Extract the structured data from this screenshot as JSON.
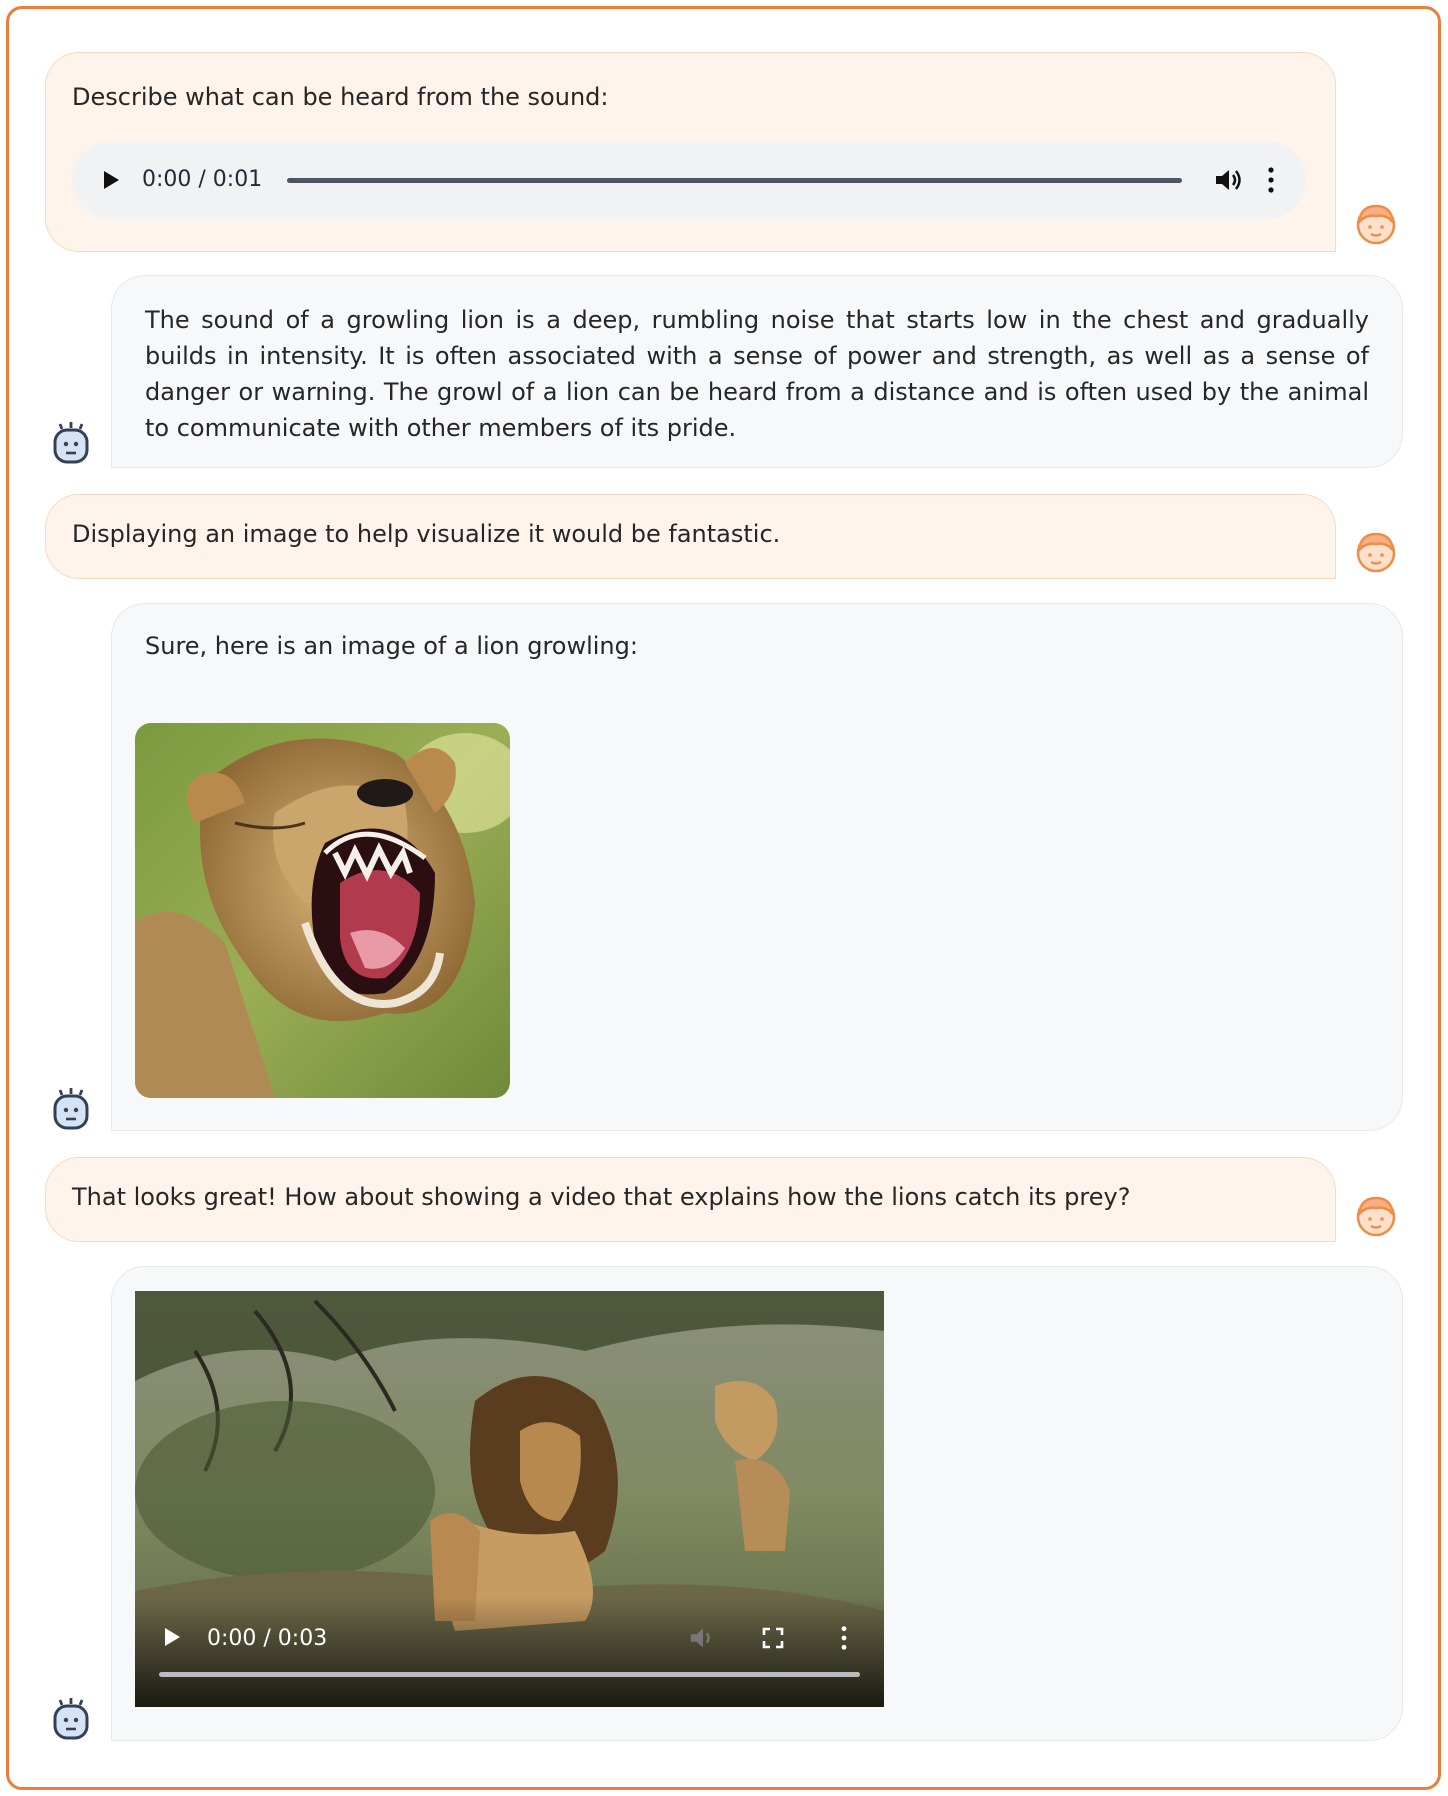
{
  "conversation": {
    "m1": {
      "text": "Describe what can be heard from the sound:",
      "audio_time": "0:00 / 0:01"
    },
    "m2": {
      "text": "The sound of a growling lion is a deep, rumbling noise that starts low in the chest and gradually builds in intensity. It is often associated with a sense of power and strength, as well as a sense of danger or warning. The growl of a lion can be heard from a distance and is often used by the animal to communicate with other members of its pride."
    },
    "m3": {
      "text": "Displaying an image to help visualize it would be fantastic."
    },
    "m4": {
      "text": "Sure, here is an image of a lion growling:"
    },
    "m5": {
      "text": "That looks great! How about showing a video that explains how the lions catch its prey?"
    },
    "m6": {
      "video_time": "0:00 / 0:03"
    }
  },
  "icons": {
    "user_avatar": "user-avatar-icon",
    "bot_avatar": "robot-avatar-icon",
    "play": "play-icon",
    "volume": "volume-icon",
    "more": "more-vertical-icon",
    "fullscreen": "fullscreen-icon"
  },
  "colors": {
    "frame_border": "#ed7d3a",
    "user_bubble": "#fff4eb",
    "bot_bubble": "#f7f8fa",
    "user_avatar": "#f08c45",
    "bot_avatar": "#344054"
  }
}
